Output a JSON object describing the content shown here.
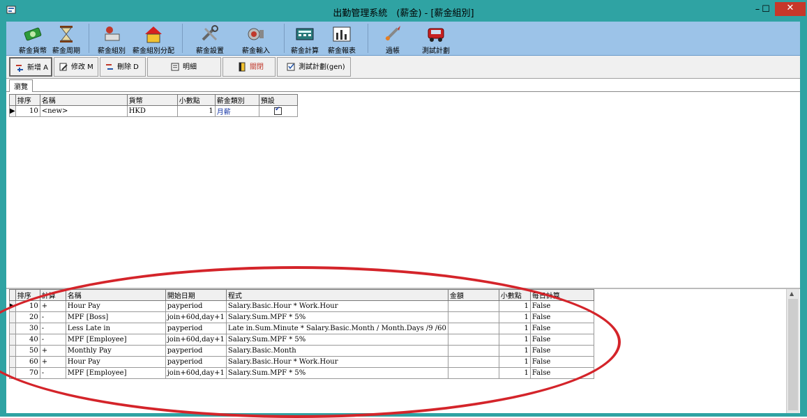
{
  "window": {
    "title": "出勤管理系統　(薪金) - [薪金組別]",
    "minimize": "–",
    "maximize": "☐",
    "close": "✕"
  },
  "toolbar1": [
    {
      "label": "薪金貨幣",
      "icon": "money-stack-icon"
    },
    {
      "label": "薪金周期",
      "icon": "hourglass-icon"
    },
    {
      "label": "薪金組別",
      "icon": "group-person-icon"
    },
    {
      "label": "薪金組別分配",
      "icon": "house-assign-icon"
    },
    {
      "label": "薪金設置",
      "icon": "tools-settings-icon"
    },
    {
      "label": "薪金輸入",
      "icon": "speaker-input-icon"
    },
    {
      "label": "薪金計算",
      "icon": "calculator-icon"
    },
    {
      "label": "薪金報表",
      "icon": "report-chart-icon"
    },
    {
      "label": "過帳",
      "icon": "post-rocket-icon"
    },
    {
      "label": "測試計劃",
      "icon": "truck-test-icon"
    }
  ],
  "toolbar2": [
    {
      "label": "新增 A",
      "icon": "add-icon"
    },
    {
      "label": "修改 M",
      "icon": "edit-icon"
    },
    {
      "label": "刪除 D",
      "icon": "delete-icon"
    },
    {
      "label": "明細",
      "icon": "detail-icon"
    },
    {
      "label": "關閉",
      "icon": "close-door-icon"
    },
    {
      "label": "測試計劃(gen)",
      "icon": "test-plan-icon"
    }
  ],
  "tab": {
    "label": "瀏覽"
  },
  "grid1": {
    "headers": [
      "排序",
      "名稱",
      "貨幣",
      "小數點",
      "薪金類別",
      "預設"
    ],
    "rows": [
      {
        "order": "10",
        "name": "<new>",
        "currency": "HKD",
        "decimal": "1",
        "category": "月薪",
        "default": true
      }
    ]
  },
  "grid2": {
    "headers": [
      "排序",
      "計算",
      "名稱",
      "開始日期",
      "程式",
      "金額",
      "小數點",
      "每日計算"
    ],
    "rows": [
      {
        "order": "10",
        "calc": "+",
        "name": "Hour Pay",
        "start": "payperiod",
        "formula": "Salary.Basic.Hour * Work.Hour",
        "amount": "",
        "decimal": "1",
        "daily": "False"
      },
      {
        "order": "20",
        "calc": "-",
        "name": "MPF [Boss]",
        "start": "join+60d,day+1",
        "formula": "Salary.Sum.MPF * 5%",
        "amount": "",
        "decimal": "1",
        "daily": "False"
      },
      {
        "order": "30",
        "calc": "-",
        "name": "Less Late in",
        "start": "payperiod",
        "formula": "Late in.Sum.Minute * Salary.Basic.Month / Month.Days /9 /60",
        "amount": "",
        "decimal": "1",
        "daily": "False"
      },
      {
        "order": "40",
        "calc": "-",
        "name": "MPF [Employee]",
        "start": "join+60d,day+1",
        "formula": "Salary.Sum.MPF * 5%",
        "amount": "",
        "decimal": "1",
        "daily": "False"
      },
      {
        "order": "50",
        "calc": "+",
        "name": "Monthly Pay",
        "start": "payperiod",
        "formula": "Salary.Basic.Month",
        "amount": "",
        "decimal": "1",
        "daily": "False"
      },
      {
        "order": "60",
        "calc": "+",
        "name": "Hour Pay",
        "start": "payperiod",
        "formula": "Salary.Basic.Hour * Work.Hour",
        "amount": "",
        "decimal": "1",
        "daily": "False"
      },
      {
        "order": "70",
        "calc": "-",
        "name": "MPF [Employee]",
        "start": "join+60d,day+1",
        "formula": "Salary.Sum.MPF * 5%",
        "amount": "",
        "decimal": "1",
        "daily": "False"
      }
    ]
  },
  "colors": {
    "titlebar": "#2fa3a3",
    "toolbar": "#9cc3e8",
    "annotation": "#d4242a",
    "link": "#1a3aa8"
  }
}
